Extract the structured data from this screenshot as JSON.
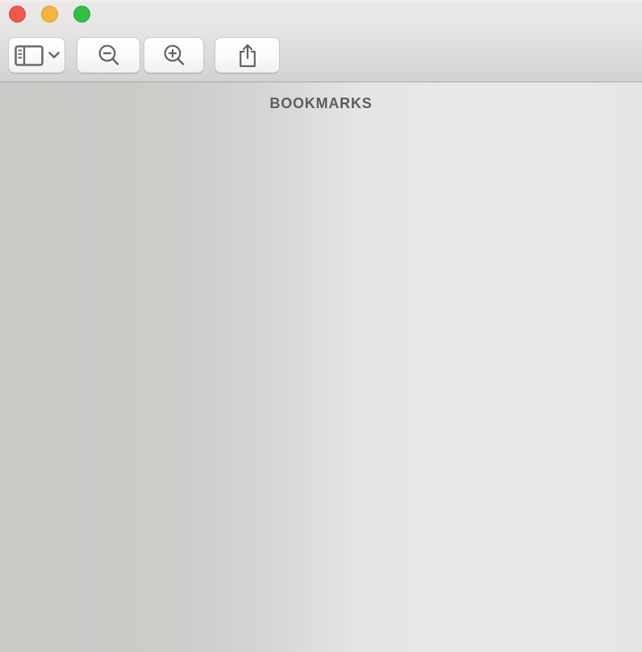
{
  "window": {
    "app": "preview",
    "controls": {
      "close_color": "#f1574e",
      "minimize_color": "#f5b53d",
      "fullscreen_color": "#30bf41"
    },
    "toolbar": {
      "buttons": [
        {
          "id": "view-menu",
          "icon": "sidebar-panel-icon",
          "secondary_icon": "chevron-down-icon",
          "label": ""
        },
        {
          "id": "zoom-out",
          "icon": "magnifier-minus-icon",
          "label": ""
        },
        {
          "id": "zoom-in",
          "icon": "magnifier-plus-icon",
          "label": ""
        },
        {
          "id": "share",
          "icon": "share-icon",
          "label": ""
        }
      ]
    },
    "content": {
      "header_label": "BOOKMARKS",
      "body_items": []
    },
    "colors": {
      "chrome_top": "#ebeae9",
      "chrome_bottom": "#d3d2d1",
      "divider": "#a7a6a4",
      "content_left": "#cbc9c6",
      "content_right": "#e9e8e6",
      "icon": "#62615f",
      "header_text": "#5e5d5c"
    }
  }
}
